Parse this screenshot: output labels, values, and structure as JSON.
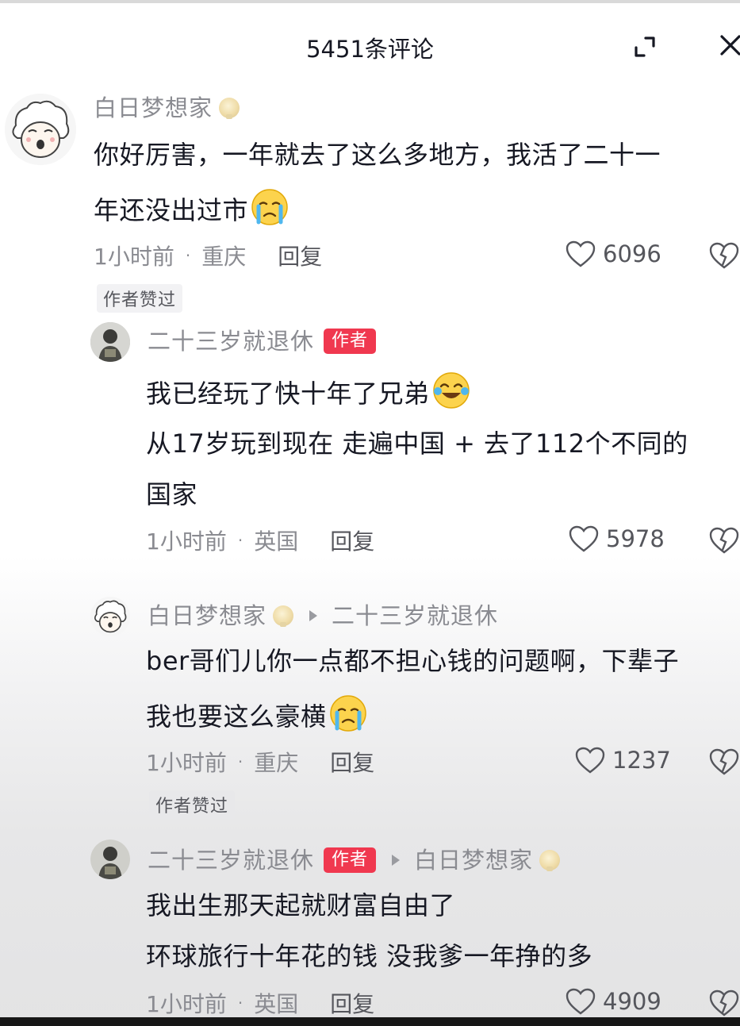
{
  "header": {
    "title": "5451条评论"
  },
  "comments": [
    {
      "user": "白日梦想家",
      "lines": [
        "你好厉害，一年就去了这么多地方，我活了二十一",
        "年还没出过市"
      ],
      "time": "1小时前",
      "location": "重庆",
      "reply_label": "回复",
      "likes": "6096",
      "author_liked": "作者赞过"
    },
    {
      "user": "二十三岁就退休",
      "author_tag": "作者",
      "lines": [
        "我已经玩了快十年了兄弟",
        "从17岁玩到现在  走遍中国 + 去了112个不同的",
        "国家"
      ],
      "time": "1小时前",
      "location": "英国",
      "reply_label": "回复",
      "likes": "5978"
    },
    {
      "user": "白日梦想家",
      "reply_to": "二十三岁就退休",
      "lines": [
        "ber哥们儿你一点都不担心钱的问题啊，下辈子",
        "我也要这么豪横"
      ],
      "time": "1小时前",
      "location": "重庆",
      "reply_label": "回复",
      "likes": "1237",
      "author_liked": "作者赞过"
    },
    {
      "user": "二十三岁就退休",
      "author_tag": "作者",
      "reply_to": "白日梦想家",
      "lines": [
        "我出生那天起就财富自由了",
        "环球旅行十年花的钱 没我爹一年挣的多"
      ],
      "time": "1小时前",
      "location": "英国",
      "reply_label": "回复",
      "likes": "4909"
    }
  ]
}
